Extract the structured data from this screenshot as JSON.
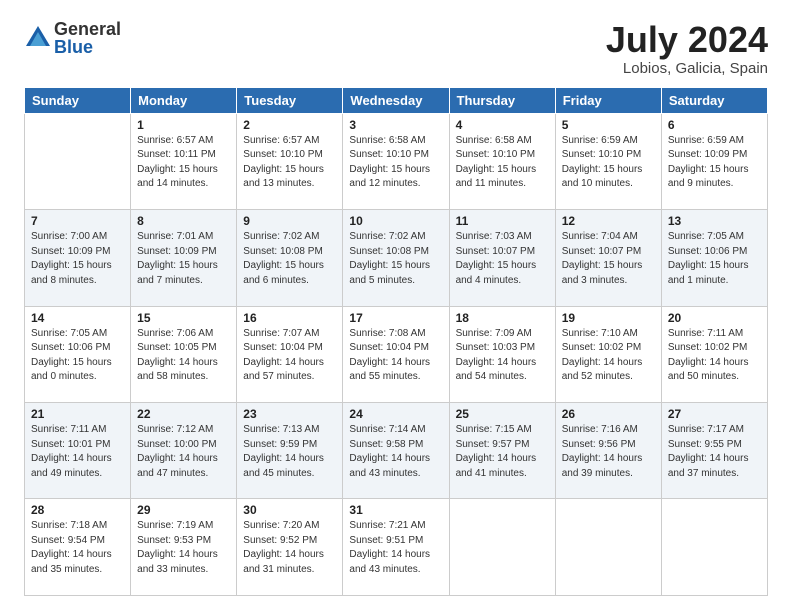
{
  "logo": {
    "general": "General",
    "blue": "Blue"
  },
  "title": "July 2024",
  "location": "Lobios, Galicia, Spain",
  "headers": [
    "Sunday",
    "Monday",
    "Tuesday",
    "Wednesday",
    "Thursday",
    "Friday",
    "Saturday"
  ],
  "weeks": [
    [
      {
        "day": "",
        "info": ""
      },
      {
        "day": "1",
        "info": "Sunrise: 6:57 AM\nSunset: 10:11 PM\nDaylight: 15 hours\nand 14 minutes."
      },
      {
        "day": "2",
        "info": "Sunrise: 6:57 AM\nSunset: 10:10 PM\nDaylight: 15 hours\nand 13 minutes."
      },
      {
        "day": "3",
        "info": "Sunrise: 6:58 AM\nSunset: 10:10 PM\nDaylight: 15 hours\nand 12 minutes."
      },
      {
        "day": "4",
        "info": "Sunrise: 6:58 AM\nSunset: 10:10 PM\nDaylight: 15 hours\nand 11 minutes."
      },
      {
        "day": "5",
        "info": "Sunrise: 6:59 AM\nSunset: 10:10 PM\nDaylight: 15 hours\nand 10 minutes."
      },
      {
        "day": "6",
        "info": "Sunrise: 6:59 AM\nSunset: 10:09 PM\nDaylight: 15 hours\nand 9 minutes."
      }
    ],
    [
      {
        "day": "7",
        "info": "Sunrise: 7:00 AM\nSunset: 10:09 PM\nDaylight: 15 hours\nand 8 minutes."
      },
      {
        "day": "8",
        "info": "Sunrise: 7:01 AM\nSunset: 10:09 PM\nDaylight: 15 hours\nand 7 minutes."
      },
      {
        "day": "9",
        "info": "Sunrise: 7:02 AM\nSunset: 10:08 PM\nDaylight: 15 hours\nand 6 minutes."
      },
      {
        "day": "10",
        "info": "Sunrise: 7:02 AM\nSunset: 10:08 PM\nDaylight: 15 hours\nand 5 minutes."
      },
      {
        "day": "11",
        "info": "Sunrise: 7:03 AM\nSunset: 10:07 PM\nDaylight: 15 hours\nand 4 minutes."
      },
      {
        "day": "12",
        "info": "Sunrise: 7:04 AM\nSunset: 10:07 PM\nDaylight: 15 hours\nand 3 minutes."
      },
      {
        "day": "13",
        "info": "Sunrise: 7:05 AM\nSunset: 10:06 PM\nDaylight: 15 hours\nand 1 minute."
      }
    ],
    [
      {
        "day": "14",
        "info": "Sunrise: 7:05 AM\nSunset: 10:06 PM\nDaylight: 15 hours\nand 0 minutes."
      },
      {
        "day": "15",
        "info": "Sunrise: 7:06 AM\nSunset: 10:05 PM\nDaylight: 14 hours\nand 58 minutes."
      },
      {
        "day": "16",
        "info": "Sunrise: 7:07 AM\nSunset: 10:04 PM\nDaylight: 14 hours\nand 57 minutes."
      },
      {
        "day": "17",
        "info": "Sunrise: 7:08 AM\nSunset: 10:04 PM\nDaylight: 14 hours\nand 55 minutes."
      },
      {
        "day": "18",
        "info": "Sunrise: 7:09 AM\nSunset: 10:03 PM\nDaylight: 14 hours\nand 54 minutes."
      },
      {
        "day": "19",
        "info": "Sunrise: 7:10 AM\nSunset: 10:02 PM\nDaylight: 14 hours\nand 52 minutes."
      },
      {
        "day": "20",
        "info": "Sunrise: 7:11 AM\nSunset: 10:02 PM\nDaylight: 14 hours\nand 50 minutes."
      }
    ],
    [
      {
        "day": "21",
        "info": "Sunrise: 7:11 AM\nSunset: 10:01 PM\nDaylight: 14 hours\nand 49 minutes."
      },
      {
        "day": "22",
        "info": "Sunrise: 7:12 AM\nSunset: 10:00 PM\nDaylight: 14 hours\nand 47 minutes."
      },
      {
        "day": "23",
        "info": "Sunrise: 7:13 AM\nSunset: 9:59 PM\nDaylight: 14 hours\nand 45 minutes."
      },
      {
        "day": "24",
        "info": "Sunrise: 7:14 AM\nSunset: 9:58 PM\nDaylight: 14 hours\nand 43 minutes."
      },
      {
        "day": "25",
        "info": "Sunrise: 7:15 AM\nSunset: 9:57 PM\nDaylight: 14 hours\nand 41 minutes."
      },
      {
        "day": "26",
        "info": "Sunrise: 7:16 AM\nSunset: 9:56 PM\nDaylight: 14 hours\nand 39 minutes."
      },
      {
        "day": "27",
        "info": "Sunrise: 7:17 AM\nSunset: 9:55 PM\nDaylight: 14 hours\nand 37 minutes."
      }
    ],
    [
      {
        "day": "28",
        "info": "Sunrise: 7:18 AM\nSunset: 9:54 PM\nDaylight: 14 hours\nand 35 minutes."
      },
      {
        "day": "29",
        "info": "Sunrise: 7:19 AM\nSunset: 9:53 PM\nDaylight: 14 hours\nand 33 minutes."
      },
      {
        "day": "30",
        "info": "Sunrise: 7:20 AM\nSunset: 9:52 PM\nDaylight: 14 hours\nand 31 minutes."
      },
      {
        "day": "31",
        "info": "Sunrise: 7:21 AM\nSunset: 9:51 PM\nDaylight: 14 hours\nand 43 minutes."
      },
      {
        "day": "",
        "info": ""
      },
      {
        "day": "",
        "info": ""
      },
      {
        "day": "",
        "info": ""
      }
    ]
  ]
}
